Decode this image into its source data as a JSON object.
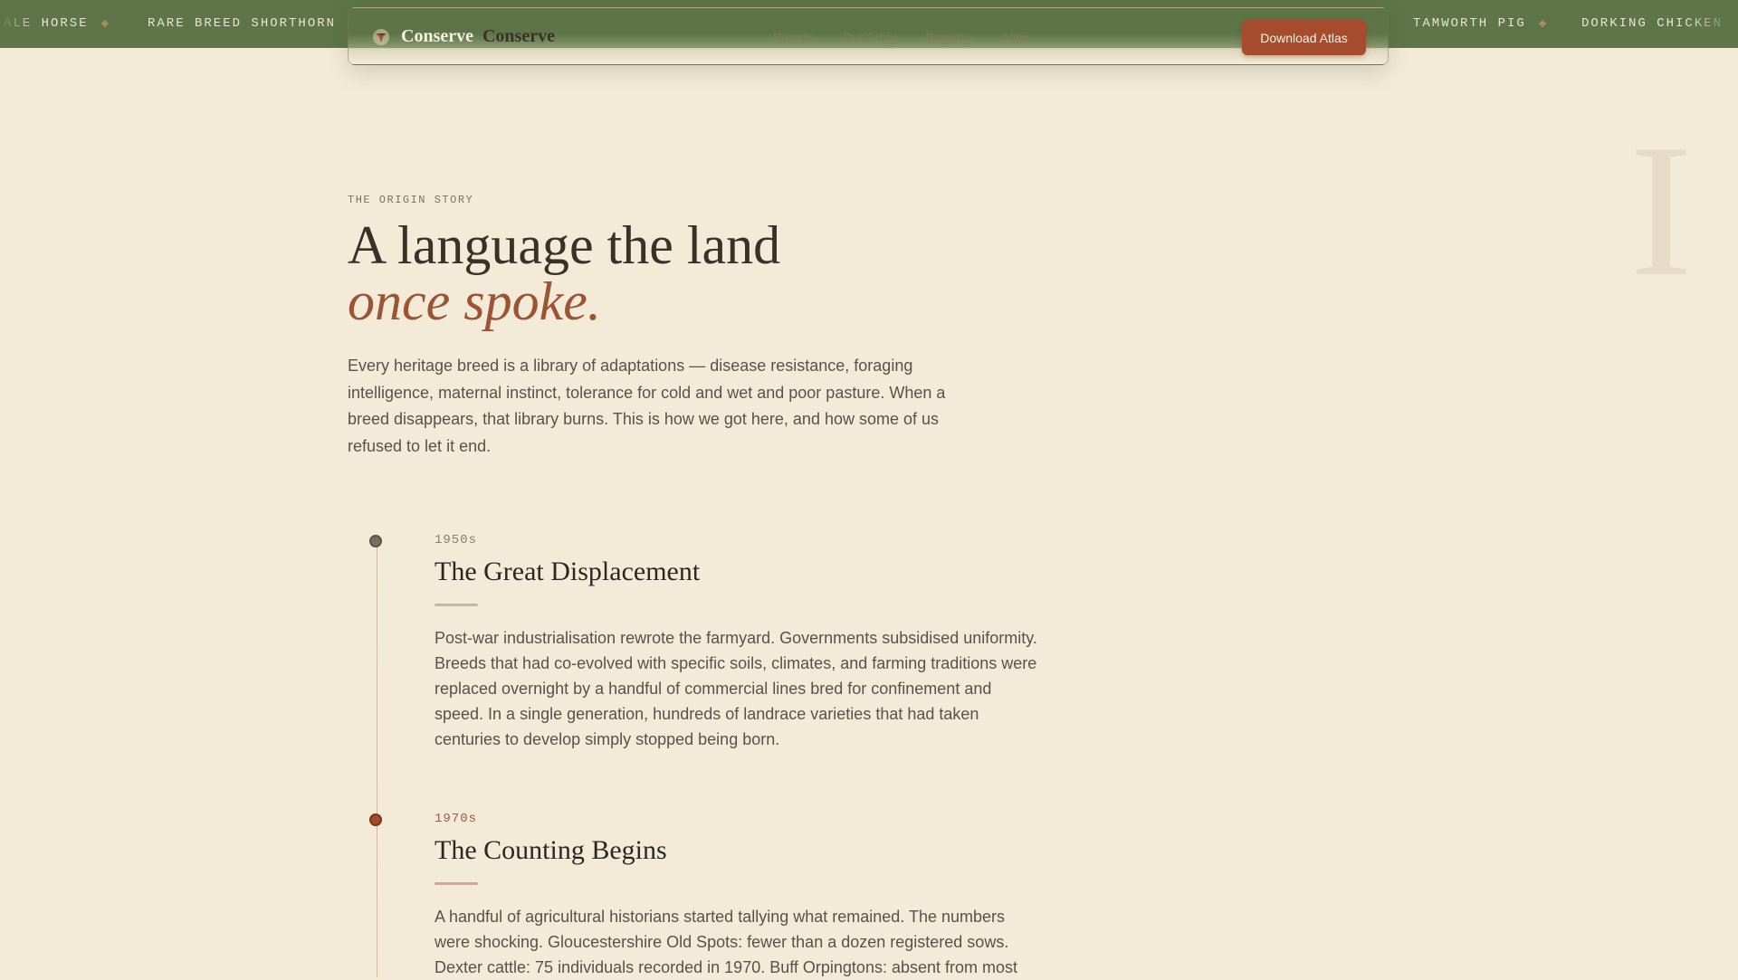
{
  "ticker": {
    "items": [
      "ALE HORSE",
      "RARE BREED SHORTHORN",
      "TAMWORTH PIG",
      "DORKING CHICKEN"
    ],
    "separator": "◆"
  },
  "nav": {
    "brand": "Conserve",
    "brand_secondary": "Conserve",
    "links": [
      "Breeds",
      "Our Story",
      "Registry",
      "Atlas"
    ],
    "cta": "Download Atlas"
  },
  "decor": {
    "letter": "I"
  },
  "hero": {
    "eyebrow": "THE ORIGIN STORY",
    "headline_line1": "A language the land",
    "headline_line2": "once spoke.",
    "lede": "Every heritage breed is a library of adaptations — disease resistance, foraging intelligence, maternal instinct, tolerance for cold and wet and poor pasture. When a breed disappears, that library burns. This is how we got here, and how some of us refused to let it end."
  },
  "timeline": [
    {
      "era": "1950s",
      "title": "The Great Displacement",
      "body": "Post-war industrialisation rewrote the farmyard. Governments subsidised uniformity. Breeds that had co-evolved with specific soils, climates, and farming traditions were replaced overnight by a handful of commercial lines bred for confinement and speed. In a single generation, hundreds of landrace varieties that had taken centuries to develop simply stopped being born."
    },
    {
      "era": "1970s",
      "title": "The Counting Begins",
      "body": "A handful of agricultural historians started tallying what remained. The numbers were shocking. Gloucestershire Old Spots: fewer than a dozen registered sows. Dexter cattle: 75 individuals recorded in 1970. Buff Orpingtons: absent from most"
    }
  ],
  "colors": {
    "ticker_bg": "#5d7548",
    "page_bg": "#f3ead8",
    "accent_rust": "#a64d2e",
    "headline_accent": "#9b5535"
  }
}
